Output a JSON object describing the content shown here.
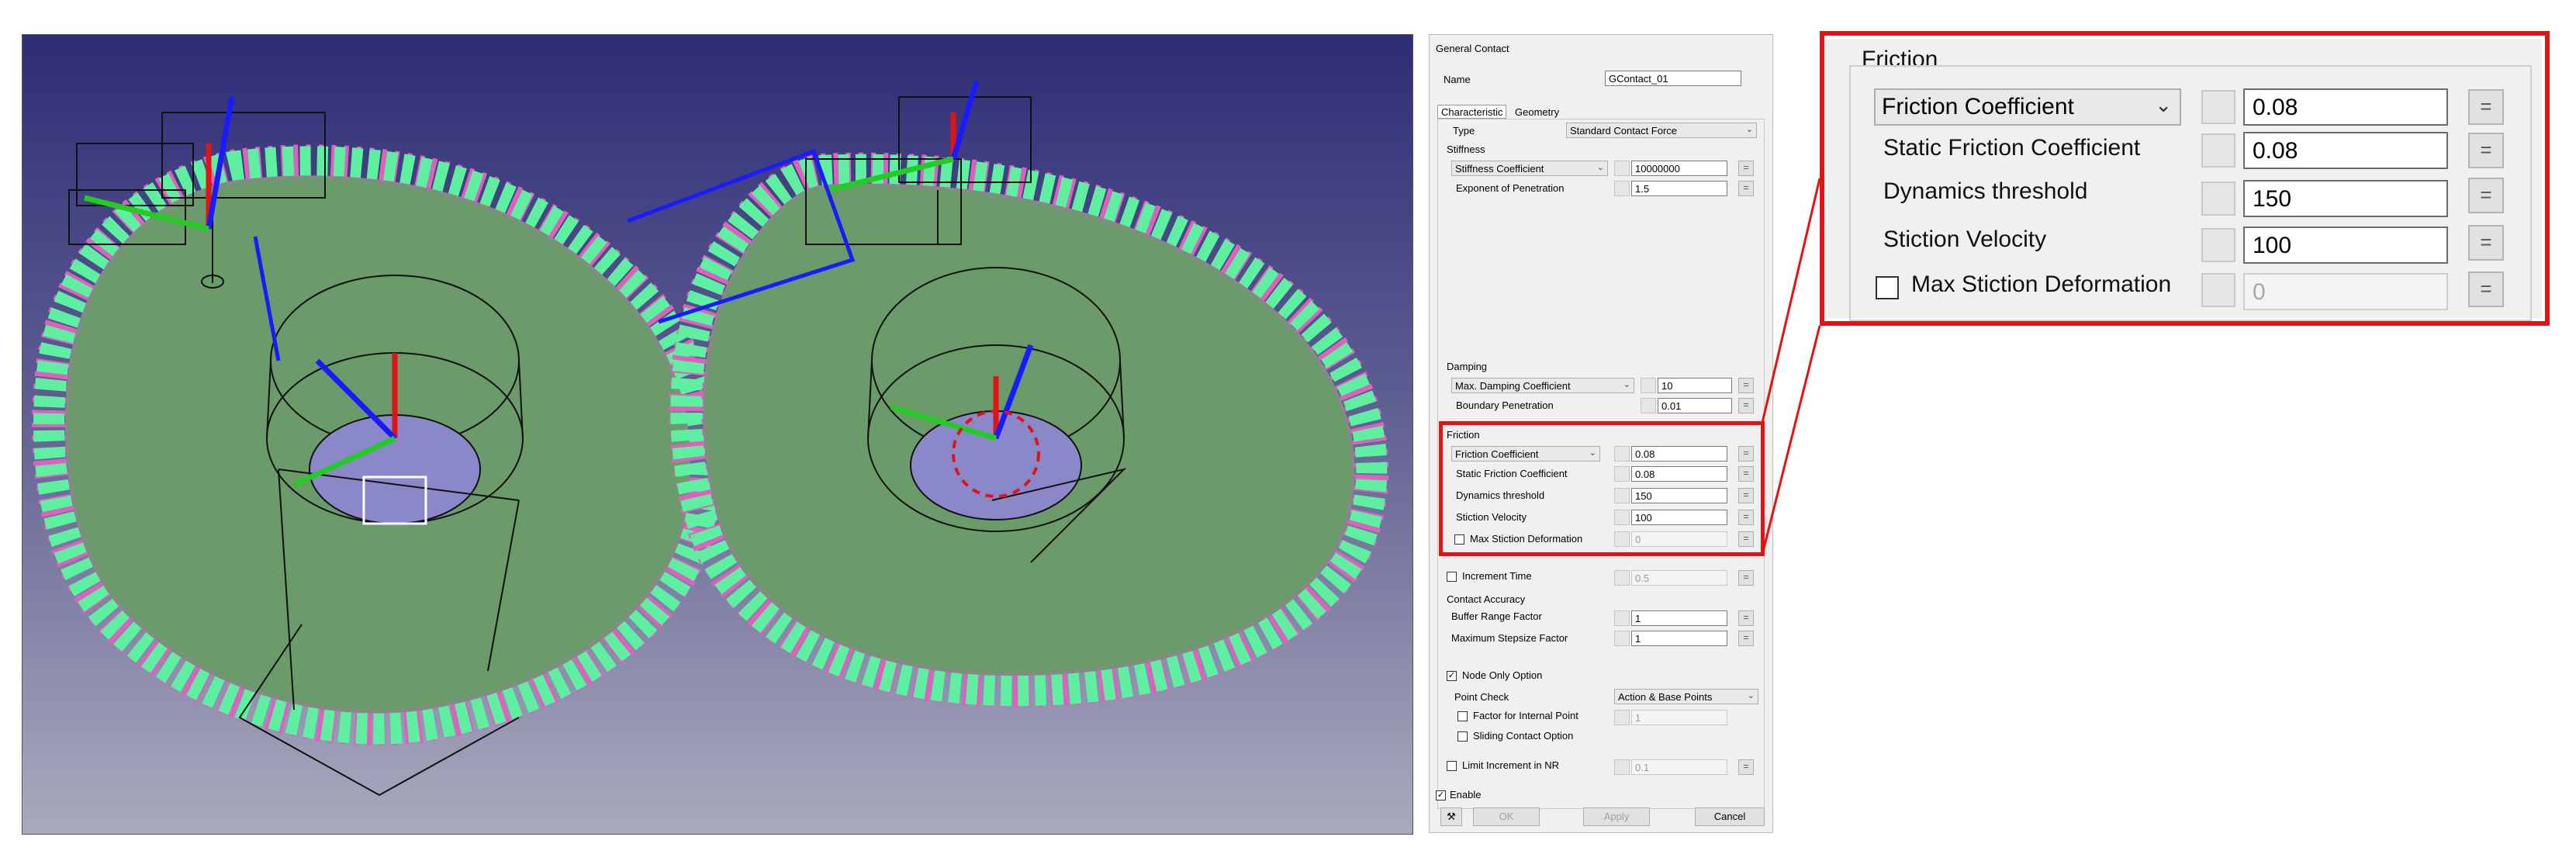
{
  "dialog": {
    "title": "General Contact",
    "name_label": "Name",
    "name_value": "GContact_01",
    "tabs": [
      "Characteristic",
      "Geometry"
    ],
    "type_label": "Type",
    "type_value": "Standard Contact Force",
    "stiffness_group": "Stiffness",
    "stiffness_coef_label": "Stiffness Coefficient",
    "stiffness_coef_value": "10000000",
    "exponent_label": "Exponent of Penetration",
    "exponent_value": "1.5",
    "damping_group": "Damping",
    "damping_coef_label": "Max. Damping Coefficient",
    "damping_coef_value": "10",
    "boundary_label": "Boundary Penetration",
    "boundary_value": "0.01",
    "friction_group": "Friction",
    "friction_coef_label": "Friction Coefficient",
    "friction_coef_value": "0.08",
    "static_friction_label": "Static Friction Coefficient",
    "static_friction_value": "0.08",
    "dynamics_threshold_label": "Dynamics threshold",
    "dynamics_threshold_value": "150",
    "stiction_velocity_label": "Stiction Velocity",
    "stiction_velocity_value": "100",
    "max_stiction_label": "Max Stiction Deformation",
    "max_stiction_value": "0",
    "increment_time_label": "Increment Time",
    "increment_time_value": "0.5",
    "accuracy_group": "Contact Accuracy",
    "buffer_label": "Buffer Range Factor",
    "buffer_value": "1",
    "max_stepsize_label": "Maximum Stepsize Factor",
    "max_stepsize_value": "1",
    "node_only_label": "Node Only Option",
    "point_check_label": "Point Check",
    "point_check_value": "Action & Base Points",
    "factor_internal_label": "Factor for Internal Point",
    "factor_internal_value": "1",
    "sliding_label": "Sliding Contact Option",
    "limit_label": "Limit Increment in NR",
    "limit_value": "0.1",
    "enable_label": "Enable",
    "ok_label": "OK",
    "apply_label": "Apply",
    "cancel_label": "Cancel"
  },
  "zoom": {
    "group": "Friction",
    "friction_coef_label": "Friction Coefficient",
    "friction_coef_value": "0.08",
    "static_friction_label": "Static Friction Coefficient",
    "static_friction_value": "0.08",
    "dynamics_threshold_label": "Dynamics threshold",
    "dynamics_threshold_value": "150",
    "stiction_velocity_label": "Stiction Velocity",
    "stiction_velocity_value": "100",
    "max_stiction_label": "Max Stiction Deformation",
    "max_stiction_value": "0"
  },
  "colors": {
    "highlight": "#e01414",
    "gear_teeth": "#5ef0a0",
    "gear_body": "#6b9a6b"
  }
}
